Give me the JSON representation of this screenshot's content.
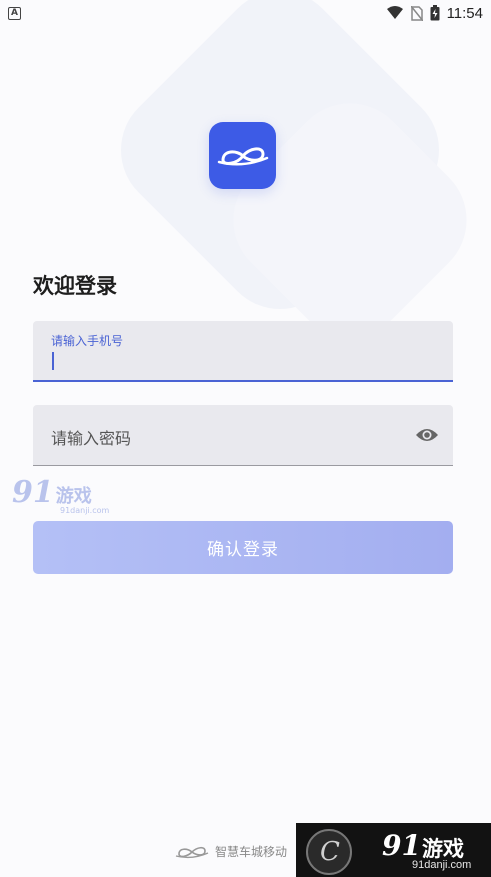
{
  "status_bar": {
    "left_icon": "A",
    "time": "11:54",
    "icons": [
      "notification-a-icon",
      "wifi-icon",
      "no-sim-icon",
      "battery-charging-icon"
    ]
  },
  "app": {
    "logo_icon": "infinity-car-logo-icon",
    "brand_color": "#3d5be6"
  },
  "login": {
    "welcome": "欢迎登录",
    "phone_label": "请输入手机号",
    "phone_value": "",
    "password_placeholder": "请输入密码",
    "password_toggle_icon": "eye-icon",
    "confirm_label": "确认登录"
  },
  "watermark": {
    "brand_91": "91",
    "brand_game": "游戏",
    "site": "91danji.com"
  },
  "footer": {
    "brand": "智慧车城移动"
  },
  "banner": {
    "letter": "C",
    "brand_91": "91",
    "brand_game": "游戏",
    "site": "91danji.com"
  }
}
